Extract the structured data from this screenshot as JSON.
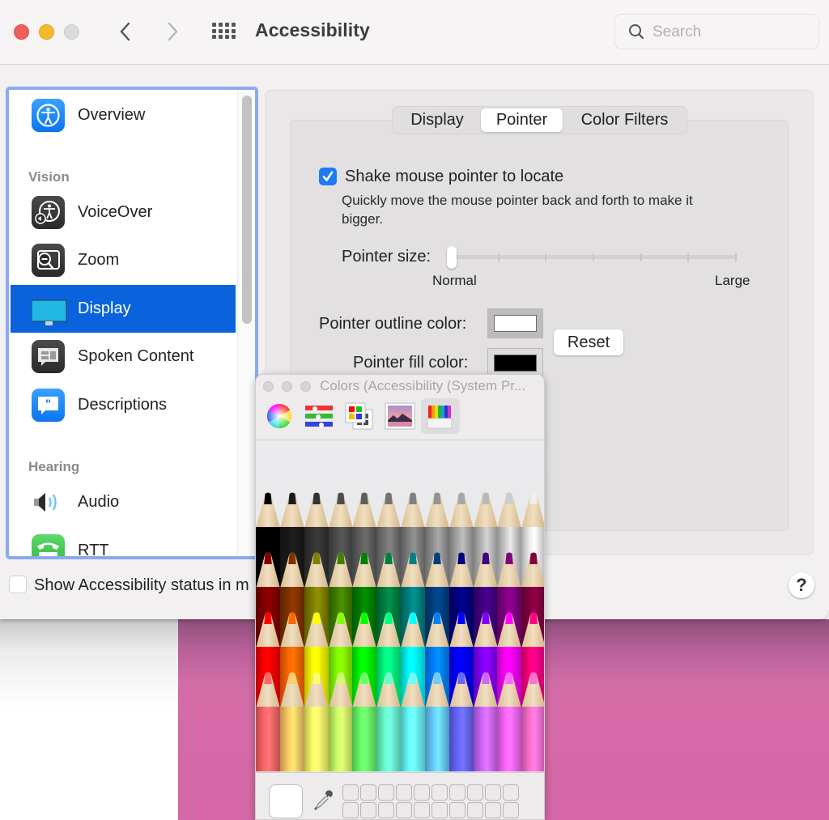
{
  "window": {
    "title": "Accessibility",
    "traffic_lights": [
      "close",
      "minimize",
      "zoom"
    ],
    "nav": {
      "back_icon": "chevron-left-icon",
      "forward_icon": "chevron-right-icon",
      "show_all_icon": "grid-icon"
    },
    "search": {
      "placeholder": "Search",
      "value": ""
    }
  },
  "sidebar": {
    "items": [
      {
        "type": "item",
        "label": "Overview",
        "icon": "accessibility-icon",
        "selected": false
      },
      {
        "type": "header",
        "label": "Vision"
      },
      {
        "type": "item",
        "label": "VoiceOver",
        "icon": "voiceover-icon",
        "selected": false
      },
      {
        "type": "item",
        "label": "Zoom",
        "icon": "zoom-icon",
        "selected": false
      },
      {
        "type": "item",
        "label": "Display",
        "icon": "display-icon",
        "selected": true
      },
      {
        "type": "item",
        "label": "Spoken Content",
        "icon": "spoken-content-icon",
        "selected": false
      },
      {
        "type": "item",
        "label": "Descriptions",
        "icon": "descriptions-icon",
        "selected": false
      },
      {
        "type": "header",
        "label": "Hearing"
      },
      {
        "type": "item",
        "label": "Audio",
        "icon": "speaker-icon",
        "selected": false
      },
      {
        "type": "item",
        "label": "RTT",
        "icon": "rtt-phone-icon",
        "selected": false
      }
    ]
  },
  "footer": {
    "show_status_label": "Show Accessibility status in m",
    "show_status_checked": false,
    "help_label": "?"
  },
  "tabs": [
    {
      "label": "Display",
      "active": false
    },
    {
      "label": "Pointer",
      "active": true
    },
    {
      "label": "Color Filters",
      "active": false
    }
  ],
  "pointer": {
    "shake_label": "Shake mouse pointer to locate",
    "shake_checked": true,
    "shake_description": "Quickly move the mouse pointer back and forth to make it bigger.",
    "size_label": "Pointer size:",
    "size_min_label": "Normal",
    "size_max_label": "Large",
    "size_value": 0,
    "size_ticks": 7,
    "outline_label": "Pointer outline color:",
    "outline_color": "#ffffff",
    "fill_label": "Pointer fill color:",
    "fill_color": "#000000",
    "reset_label": "Reset"
  },
  "colors_panel": {
    "title": "Colors (Accessibility (System Pr...",
    "modes": [
      {
        "name": "color-wheel",
        "active": false
      },
      {
        "name": "color-sliders",
        "active": false
      },
      {
        "name": "color-palettes",
        "active": false
      },
      {
        "name": "image-palettes",
        "active": false
      },
      {
        "name": "pencils",
        "active": true
      }
    ],
    "pencil_rows": [
      [
        "#000000",
        "#1a1a1a",
        "#333333",
        "#4d4d4d",
        "#5f5f5f",
        "#737373",
        "#808080",
        "#939393",
        "#a6a6a6",
        "#b8b8b8",
        "#cccccc",
        "#eeeeee"
      ],
      [
        "#800000",
        "#803300",
        "#808000",
        "#408000",
        "#008000",
        "#008040",
        "#008080",
        "#004080",
        "#000080",
        "#400080",
        "#800080",
        "#800040"
      ],
      [
        "#ff0000",
        "#ff6600",
        "#ffff00",
        "#80ff00",
        "#00ff00",
        "#00ff80",
        "#00ffff",
        "#0080ff",
        "#0000ff",
        "#8000ff",
        "#ff00ff",
        "#ff0080"
      ],
      [
        "#ff6666",
        "#ffcc66",
        "#ffff66",
        "#ccff66",
        "#66ff66",
        "#66ffcc",
        "#66ffff",
        "#66ccff",
        "#6666ff",
        "#cc66ff",
        "#ff66ff",
        "#ff6fcf"
      ]
    ],
    "current_color": "#ffffff",
    "favorite_slots": 20
  }
}
